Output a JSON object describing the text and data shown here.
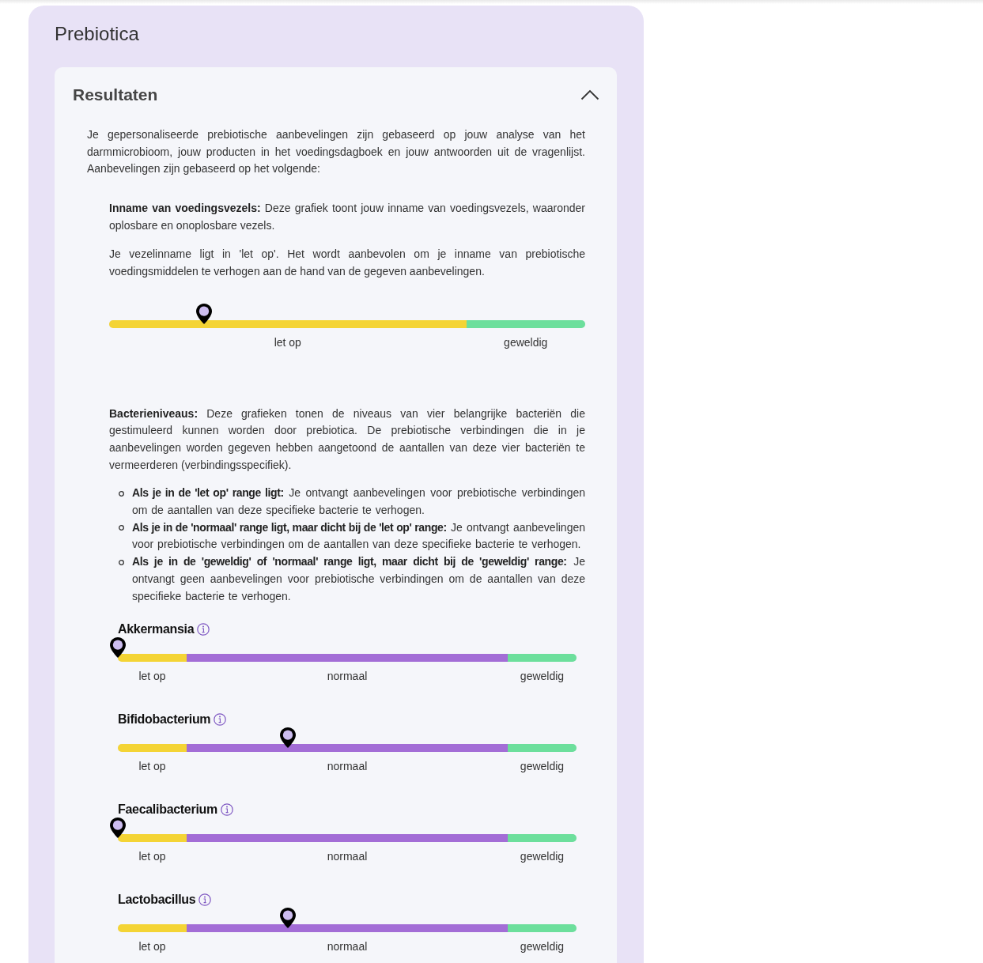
{
  "page": {
    "title": "Prebiotica"
  },
  "results": {
    "title": "Resultaten",
    "expanded": true,
    "intro": "Je gepersonaliseerde prebiotische aanbevelingen zijn gebaseerd op jouw analyse van het darmmicrobioom, jouw producten in het voedingsdagboek en jouw antwoorden uit de vragenlijst. Aanbevelingen zijn gebaseerd op het volgende:",
    "fiber": {
      "paragraphs": [
        "**Inname van voedingsvezels:** Deze grafiek toont jouw inname van voedingsvezels, waaronder oplosbare en onoplosbare vezels.",
        "Je vezelinname ligt in 'let op'. Het wordt aanbevolen om je inname van prebiotische voedingsmiddelen te verhogen aan de hand van de gegeven aanbevelingen."
      ],
      "scale": {
        "level": 0.2,
        "segments": [
          {
            "label": "let op",
            "color": "#f4d435",
            "level": 0.75
          },
          {
            "label": "geweldig",
            "color": "#6cdf9c",
            "level": 0.25
          }
        ]
      }
    },
    "bacteria": {
      "description": "**Bacterieniveaus:** Deze grafieken tonen de niveaus van vier belangrijke bacteriën die gestimuleerd kunnen worden door prebiotica. De prebiotische verbindingen die in je aanbevelingen worden gegeven hebben aangetoond de aantallen van deze vier bacteriën te vermeerderen (verbindingsspecifiek).",
      "rules": [
        "**Als je in de 'let op' range ligt:** Je ontvangt aanbevelingen voor prebiotische verbindingen om de aantallen van deze specifieke bacterie te verhogen.",
        "**Als je in de 'normaal' range ligt, maar dicht bij de 'let op' range:** Je ontvangt aanbevelingen voor prebiotische verbindingen om de aantallen van deze specifieke bacterie te verhogen.",
        "**Als je in de 'geweldig' of 'normaal' range ligt, maar dicht bij de 'geweldig' range:** Je ontvangt geen aanbevelingen voor prebiotische verbindingen om de aantallen van deze specifieke bacterie te verhogen."
      ],
      "charts": [
        {
          "name": "Akkermansia",
          "scale": {
            "level": 0,
            "segments": [
              {
                "label": "let op",
                "color": "#f4d435",
                "level": 0.15
              },
              {
                "label": "normaal",
                "color": "#a36dd6"
              },
              {
                "label": "geweldig",
                "color": "#6cdf9c",
                "level": 0.15
              }
            ]
          }
        },
        {
          "name": "Bifidobacterium",
          "scale": {
            "level": 0.37,
            "segments": [
              {
                "label": "let op",
                "color": "#f4d435",
                "level": 0.15
              },
              {
                "label": "normaal",
                "color": "#a36dd6"
              },
              {
                "label": "geweldig",
                "color": "#6cdf9c",
                "level": 0.15
              }
            ]
          }
        },
        {
          "name": "Faecalibacterium",
          "scale": {
            "level": 0,
            "segments": [
              {
                "label": "let op",
                "color": "#f4d435",
                "level": 0.15
              },
              {
                "label": "normaal",
                "color": "#a36dd6"
              },
              {
                "label": "geweldig",
                "color": "#6cdf9c",
                "level": 0.15
              }
            ]
          }
        },
        {
          "name": "Lactobacillus",
          "scale": {
            "level": 0.37,
            "segments": [
              {
                "label": "let op",
                "color": "#f4d435",
                "level": 0.15
              },
              {
                "label": "normaal",
                "color": "#a36dd6"
              },
              {
                "label": "geweldig",
                "color": "#6cdf9c",
                "level": 0.15
              }
            ]
          }
        }
      ]
    }
  }
}
